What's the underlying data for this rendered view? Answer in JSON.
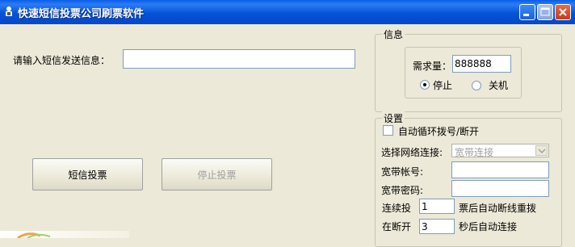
{
  "window": {
    "title": "快速短信投票公司刷票软件"
  },
  "main": {
    "message_label": "请输入短信发送信息：",
    "message_value": "",
    "vote_button": "短信投票",
    "stop_button": "停止投票"
  },
  "info": {
    "legend": "信息",
    "demand_label": "需求量：",
    "demand_value": "888888",
    "stop_option": "停止",
    "shutdown_option": "关机",
    "selected": "停止"
  },
  "settings": {
    "legend": "设置",
    "auto_dial_label": "自动循环拨号/断开",
    "auto_dial_checked": false,
    "network_label": "选择网络连接:",
    "network_value": "宽带连接",
    "account_label": "宽带帐号:",
    "account_value": "",
    "password_label": "宽带密码:",
    "password_value": "",
    "cont_prefix": "连续投",
    "cont_value": "1",
    "cont_suffix": "票后自动断线重拨",
    "reconnect_prefix": "在断开",
    "reconnect_value": "3",
    "reconnect_suffix": "秒后自动连接"
  },
  "colors": {
    "titlebar": "#0553d8",
    "face": "#ece9d8",
    "disabled_text": "#a0a0a0",
    "input_border": "#7f9db9"
  },
  "icons": [
    "app-icon",
    "minimize-icon",
    "maximize-icon",
    "close-icon",
    "dropdown-arrow-icon"
  ]
}
